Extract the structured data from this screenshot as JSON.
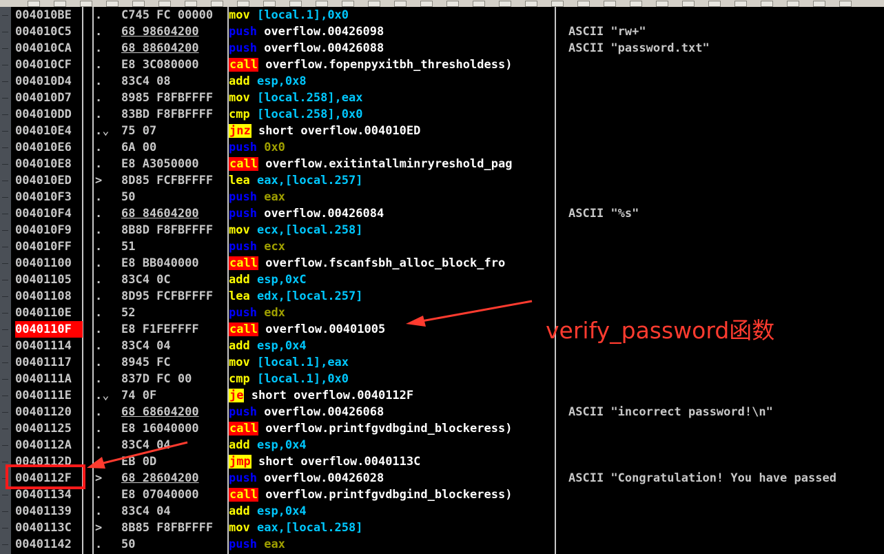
{
  "rows": [
    {
      "addr": "004010BE",
      "mark": ".",
      "hex": "C745 FC 00000",
      "mnemonic": "mov",
      "operand": "[local.1],0x0",
      "comment": ""
    },
    {
      "addr": "004010C5",
      "mark": ".",
      "hex": "68 98604200",
      "mnemonic": "push",
      "operand": "overflow.00426098",
      "comment": "ASCII \"rw+\""
    },
    {
      "addr": "004010CA",
      "mark": ".",
      "hex": "68 88604200",
      "mnemonic": "push",
      "operand": "overflow.00426088",
      "comment": "ASCII \"password.txt\""
    },
    {
      "addr": "004010CF",
      "mark": ".",
      "hex": "E8 3C080000",
      "mnemonic": "call",
      "operand": "overflow.fopenpyxitbh_thresholdess)",
      "comment": ""
    },
    {
      "addr": "004010D4",
      "mark": ".",
      "hex": "83C4 08",
      "mnemonic": "add",
      "operand": "esp,0x8",
      "comment": ""
    },
    {
      "addr": "004010D7",
      "mark": ".",
      "hex": "8985 F8FBFFFF",
      "mnemonic": "mov",
      "operand": "[local.258],eax",
      "comment": ""
    },
    {
      "addr": "004010DD",
      "mark": ".",
      "hex": "83BD F8FBFFFF",
      "mnemonic": "cmp",
      "operand": "[local.258],0x0",
      "comment": ""
    },
    {
      "addr": "004010E4",
      "mark": ".⌄",
      "hex": "75 07",
      "mnemonic": "jnz",
      "operand": "short overflow.004010ED",
      "comment": ""
    },
    {
      "addr": "004010E6",
      "mark": ".",
      "hex": "6A 00",
      "mnemonic": "push",
      "operand": "0x0",
      "comment": ""
    },
    {
      "addr": "004010E8",
      "mark": ".",
      "hex": "E8 A3050000",
      "mnemonic": "call",
      "operand": "overflow.exitintallminryreshold_pag",
      "comment": ""
    },
    {
      "addr": "004010ED",
      "mark": ">",
      "hex": "8D85 FCFBFFFF",
      "mnemonic": "lea",
      "operand": "eax,[local.257]",
      "comment": ""
    },
    {
      "addr": "004010F3",
      "mark": ".",
      "hex": "50",
      "mnemonic": "push",
      "operand": "eax",
      "comment": ""
    },
    {
      "addr": "004010F4",
      "mark": ".",
      "hex": "68 84604200",
      "mnemonic": "push",
      "operand": "overflow.00426084",
      "comment": "ASCII \"%s\""
    },
    {
      "addr": "004010F9",
      "mark": ".",
      "hex": "8B8D F8FBFFFF",
      "mnemonic": "mov",
      "operand": "ecx,[local.258]",
      "comment": ""
    },
    {
      "addr": "004010FF",
      "mark": ".",
      "hex": "51",
      "mnemonic": "push",
      "operand": "ecx",
      "comment": ""
    },
    {
      "addr": "00401100",
      "mark": ".",
      "hex": "E8 BB040000",
      "mnemonic": "call",
      "operand": "overflow.fscanfsbh_alloc_block_fro",
      "comment": ""
    },
    {
      "addr": "00401105",
      "mark": ".",
      "hex": "83C4 0C",
      "mnemonic": "add",
      "operand": "esp,0xC",
      "comment": ""
    },
    {
      "addr": "00401108",
      "mark": ".",
      "hex": "8D95 FCFBFFFF",
      "mnemonic": "lea",
      "operand": "edx,[local.257]",
      "comment": ""
    },
    {
      "addr": "0040110E",
      "mark": ".",
      "hex": "52",
      "mnemonic": "push",
      "operand": "edx",
      "comment": ""
    },
    {
      "addr": "0040110F",
      "mark": ".",
      "hex": "E8 F1FEFFFF",
      "mnemonic": "call",
      "operand": "overflow.00401005",
      "comment": ""
    },
    {
      "addr": "00401114",
      "mark": ".",
      "hex": "83C4 04",
      "mnemonic": "add",
      "operand": "esp,0x4",
      "comment": ""
    },
    {
      "addr": "00401117",
      "mark": ".",
      "hex": "8945 FC",
      "mnemonic": "mov",
      "operand": "[local.1],eax",
      "comment": ""
    },
    {
      "addr": "0040111A",
      "mark": ".",
      "hex": "837D FC 00",
      "mnemonic": "cmp",
      "operand": "[local.1],0x0",
      "comment": ""
    },
    {
      "addr": "0040111E",
      "mark": ".⌄",
      "hex": "74 0F",
      "mnemonic": "je",
      "operand": "short overflow.0040112F",
      "comment": ""
    },
    {
      "addr": "00401120",
      "mark": ".",
      "hex": "68 68604200",
      "mnemonic": "push",
      "operand": "overflow.00426068",
      "comment": "ASCII \"incorrect password!\\n\""
    },
    {
      "addr": "00401125",
      "mark": ".",
      "hex": "E8 16040000",
      "mnemonic": "call",
      "operand": "overflow.printfgvdbgind_blockeress)",
      "comment": ""
    },
    {
      "addr": "0040112A",
      "mark": ".",
      "hex": "83C4 04",
      "mnemonic": "add",
      "operand": "esp,0x4",
      "comment": ""
    },
    {
      "addr": "0040112D",
      "mark": ".",
      "hex": "EB 0D",
      "mnemonic": "jmp",
      "operand": "short overflow.0040113C",
      "comment": ""
    },
    {
      "addr": "0040112F",
      "mark": ">",
      "hex": "68 28604200",
      "mnemonic": "push",
      "operand": "overflow.00426028",
      "comment": "ASCII \"Congratulation! You have passed"
    },
    {
      "addr": "00401134",
      "mark": ".",
      "hex": "E8 07040000",
      "mnemonic": "call",
      "operand": "overflow.printfgvdbgind_blockeress)",
      "comment": ""
    },
    {
      "addr": "00401139",
      "mark": ".",
      "hex": "83C4 04",
      "mnemonic": "add",
      "operand": "esp,0x4",
      "comment": ""
    },
    {
      "addr": "0040113C",
      "mark": ">",
      "hex": "8B85 F8FBFFFF",
      "mnemonic": "mov",
      "operand": "eax,[local.258]",
      "comment": ""
    },
    {
      "addr": "00401142",
      "mark": ".",
      "hex": "50",
      "mnemonic": "push",
      "operand": "eax",
      "comment": ""
    }
  ],
  "highlighted_addr": "0040110F",
  "annotation": {
    "label": "verify_password函数"
  },
  "colors": {
    "background": "#000000",
    "text": "#c8c8c8",
    "highlight": "#ff0000",
    "mnemonic_yellow": "#ffff00",
    "mnemonic_push": "#0000ff",
    "annotation_red": "#ff3b2f"
  }
}
